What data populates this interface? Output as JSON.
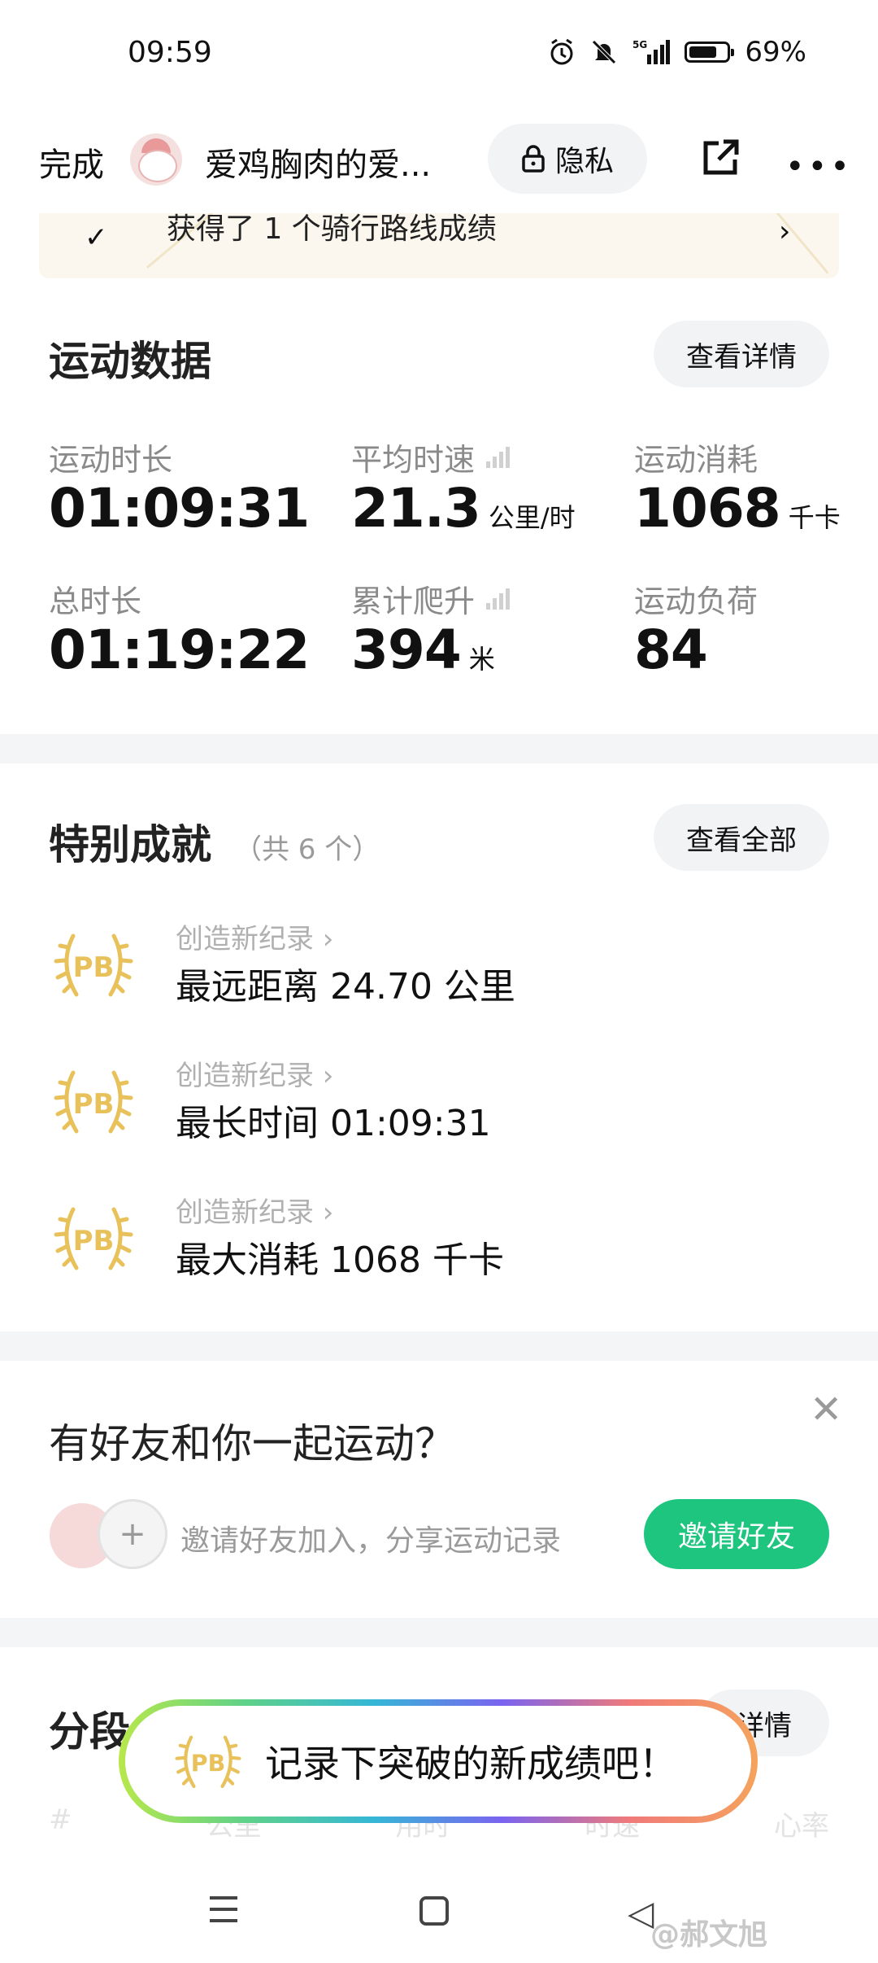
{
  "status_bar": {
    "time": "09:59",
    "battery": "69%",
    "network": "5G"
  },
  "header": {
    "done_label": "完成",
    "user_name": "爱鸡胸肉的爱...",
    "privacy_label": "隐私"
  },
  "banner": {
    "text": "获得了 1 个骑行路线成绩"
  },
  "sport_data": {
    "title": "运动数据",
    "details_button": "查看详情",
    "stats": [
      {
        "label": "运动时长",
        "value": "01:09:31",
        "unit": ""
      },
      {
        "label": "平均时速",
        "value": "21.3",
        "unit": "公里/时"
      },
      {
        "label": "运动消耗",
        "value": "1068",
        "unit": "千卡"
      },
      {
        "label": "总时长",
        "value": "01:19:22",
        "unit": ""
      },
      {
        "label": "累计爬升",
        "value": "394",
        "unit": "米"
      },
      {
        "label": "运动负荷",
        "value": "84",
        "unit": ""
      }
    ]
  },
  "achievements": {
    "title": "特别成就",
    "count_label": "（共 6 个）",
    "view_all_button": "查看全部",
    "badge_text": "PB",
    "items": [
      {
        "subtitle": "创造新纪录",
        "text": "最远距离 24.70 公里"
      },
      {
        "subtitle": "创造新纪录",
        "text": "最长时间 01:09:31"
      },
      {
        "subtitle": "创造新纪录",
        "text": "最大消耗 1068 千卡"
      }
    ]
  },
  "invite": {
    "title": "有好友和你一起运动？",
    "text": "邀请好友加入，分享运动记录",
    "button": "邀请好友",
    "plus": "+"
  },
  "segments": {
    "title": "分段",
    "details_button": "详情",
    "columns": [
      "#",
      "公里",
      "用时",
      "时速",
      "心率"
    ]
  },
  "toast": {
    "badge_text": "PB",
    "text": "记录下突破的新成绩吧！"
  },
  "watermark": "@郝文旭",
  "colors": {
    "accent_green": "#1ec57f",
    "pb_gold": "#e8c15a"
  }
}
